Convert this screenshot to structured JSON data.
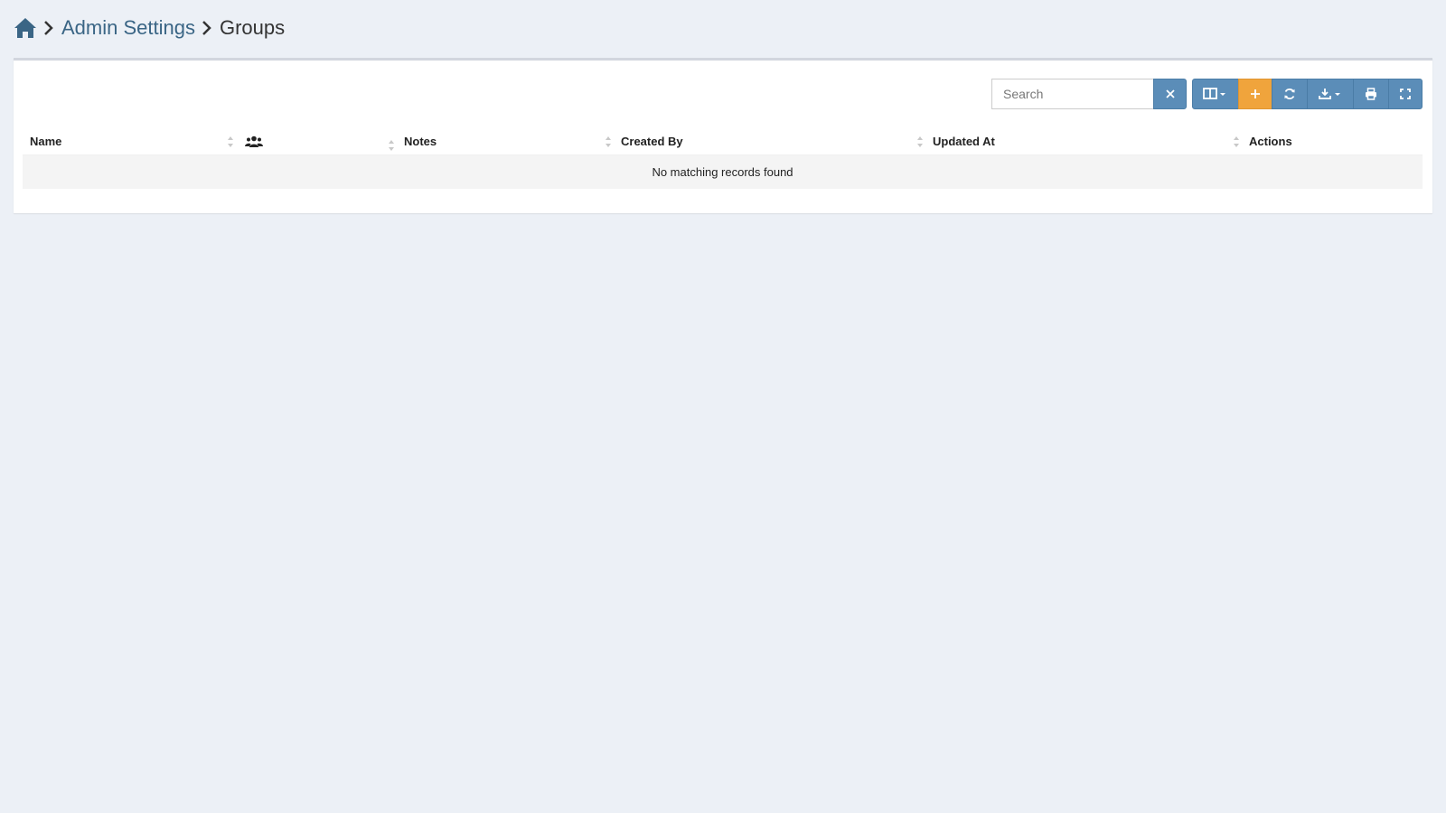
{
  "breadcrumb": {
    "home_icon": "home-icon",
    "admin_label": "Admin Settings",
    "current_label": "Groups"
  },
  "toolbar": {
    "search_placeholder": "Search",
    "clear_icon": "close-icon",
    "buttons": [
      "columns-icon",
      "plus-icon",
      "refresh-icon",
      "download-icon",
      "print-icon",
      "fullscreen-icon"
    ]
  },
  "table": {
    "columns": [
      {
        "label": "Name",
        "sortable": true
      },
      {
        "label": "",
        "icon": "users-icon",
        "sortable": true
      },
      {
        "label": "Notes",
        "sortable": true
      },
      {
        "label": "Created By",
        "sortable": true
      },
      {
        "label": "Updated At",
        "sortable": true
      },
      {
        "label": "Actions",
        "sortable": false
      }
    ],
    "empty_message": "No matching records found"
  },
  "colors": {
    "primary": "#5b8db8",
    "accent": "#f0a43c",
    "link": "#3a6585",
    "background": "#ecf0f6"
  }
}
